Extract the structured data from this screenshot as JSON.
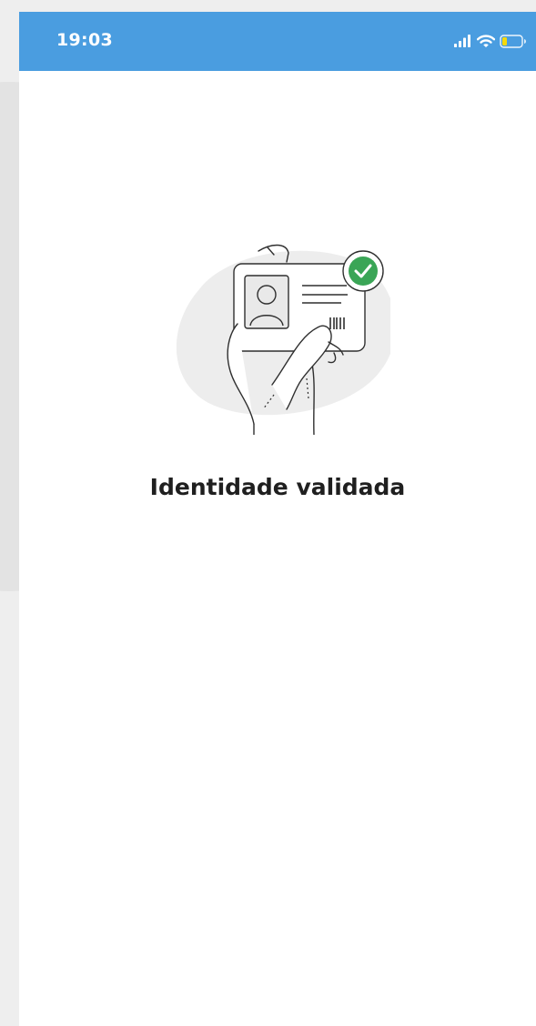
{
  "status_bar": {
    "time": "19:03",
    "icons": [
      "signal-icon",
      "wifi-icon",
      "battery-icon"
    ],
    "color": "#4a9de0",
    "battery_color": "#f5d90a"
  },
  "main": {
    "title": "Identidade validada",
    "illustration": "id-card-validated-illustration",
    "check_color": "#3aa556"
  }
}
